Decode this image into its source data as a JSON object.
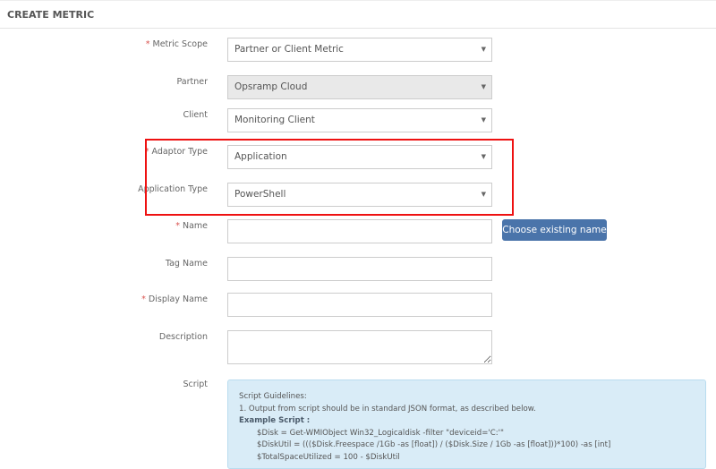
{
  "header": {
    "title": "CREATE METRIC"
  },
  "form": {
    "metric_scope": {
      "label": "Metric Scope",
      "value": "Partner or Client Metric",
      "required": true
    },
    "partner": {
      "label": "Partner",
      "value": "Opsramp Cloud",
      "disabled": true
    },
    "client": {
      "label": "Client",
      "value": "Monitoring Client"
    },
    "adaptor_type": {
      "label": "Adaptor Type",
      "value": "Application",
      "required": true
    },
    "application_type": {
      "label": "Application Type",
      "value": "PowerShell"
    },
    "name": {
      "label": "Name",
      "value": "",
      "required": true,
      "button": "Choose existing name"
    },
    "tag_name": {
      "label": "Tag Name",
      "value": ""
    },
    "display_name": {
      "label": "Display Name",
      "value": "",
      "required": true
    },
    "description": {
      "label": "Description",
      "value": ""
    },
    "script": {
      "label": "Script",
      "guidelines_title": "Script Guidelines:",
      "guideline_1": "1. Output from script should be in standard JSON format, as described below.",
      "example_title": "Example Script :",
      "lines": [
        "$Disk = Get-WMIObject Win32_Logicaldisk -filter \"deviceid='C:'\"",
        "$DiskUtil = ((($Disk.Freespace /1Gb -as [float]) / ($Disk.Size / 1Gb -as [float]))*100) -as [int]",
        "$TotalSpaceUtilized = 100 - $DiskUtil"
      ]
    }
  },
  "highlight_color": "#ee1111",
  "button_color": "#4a74aa"
}
